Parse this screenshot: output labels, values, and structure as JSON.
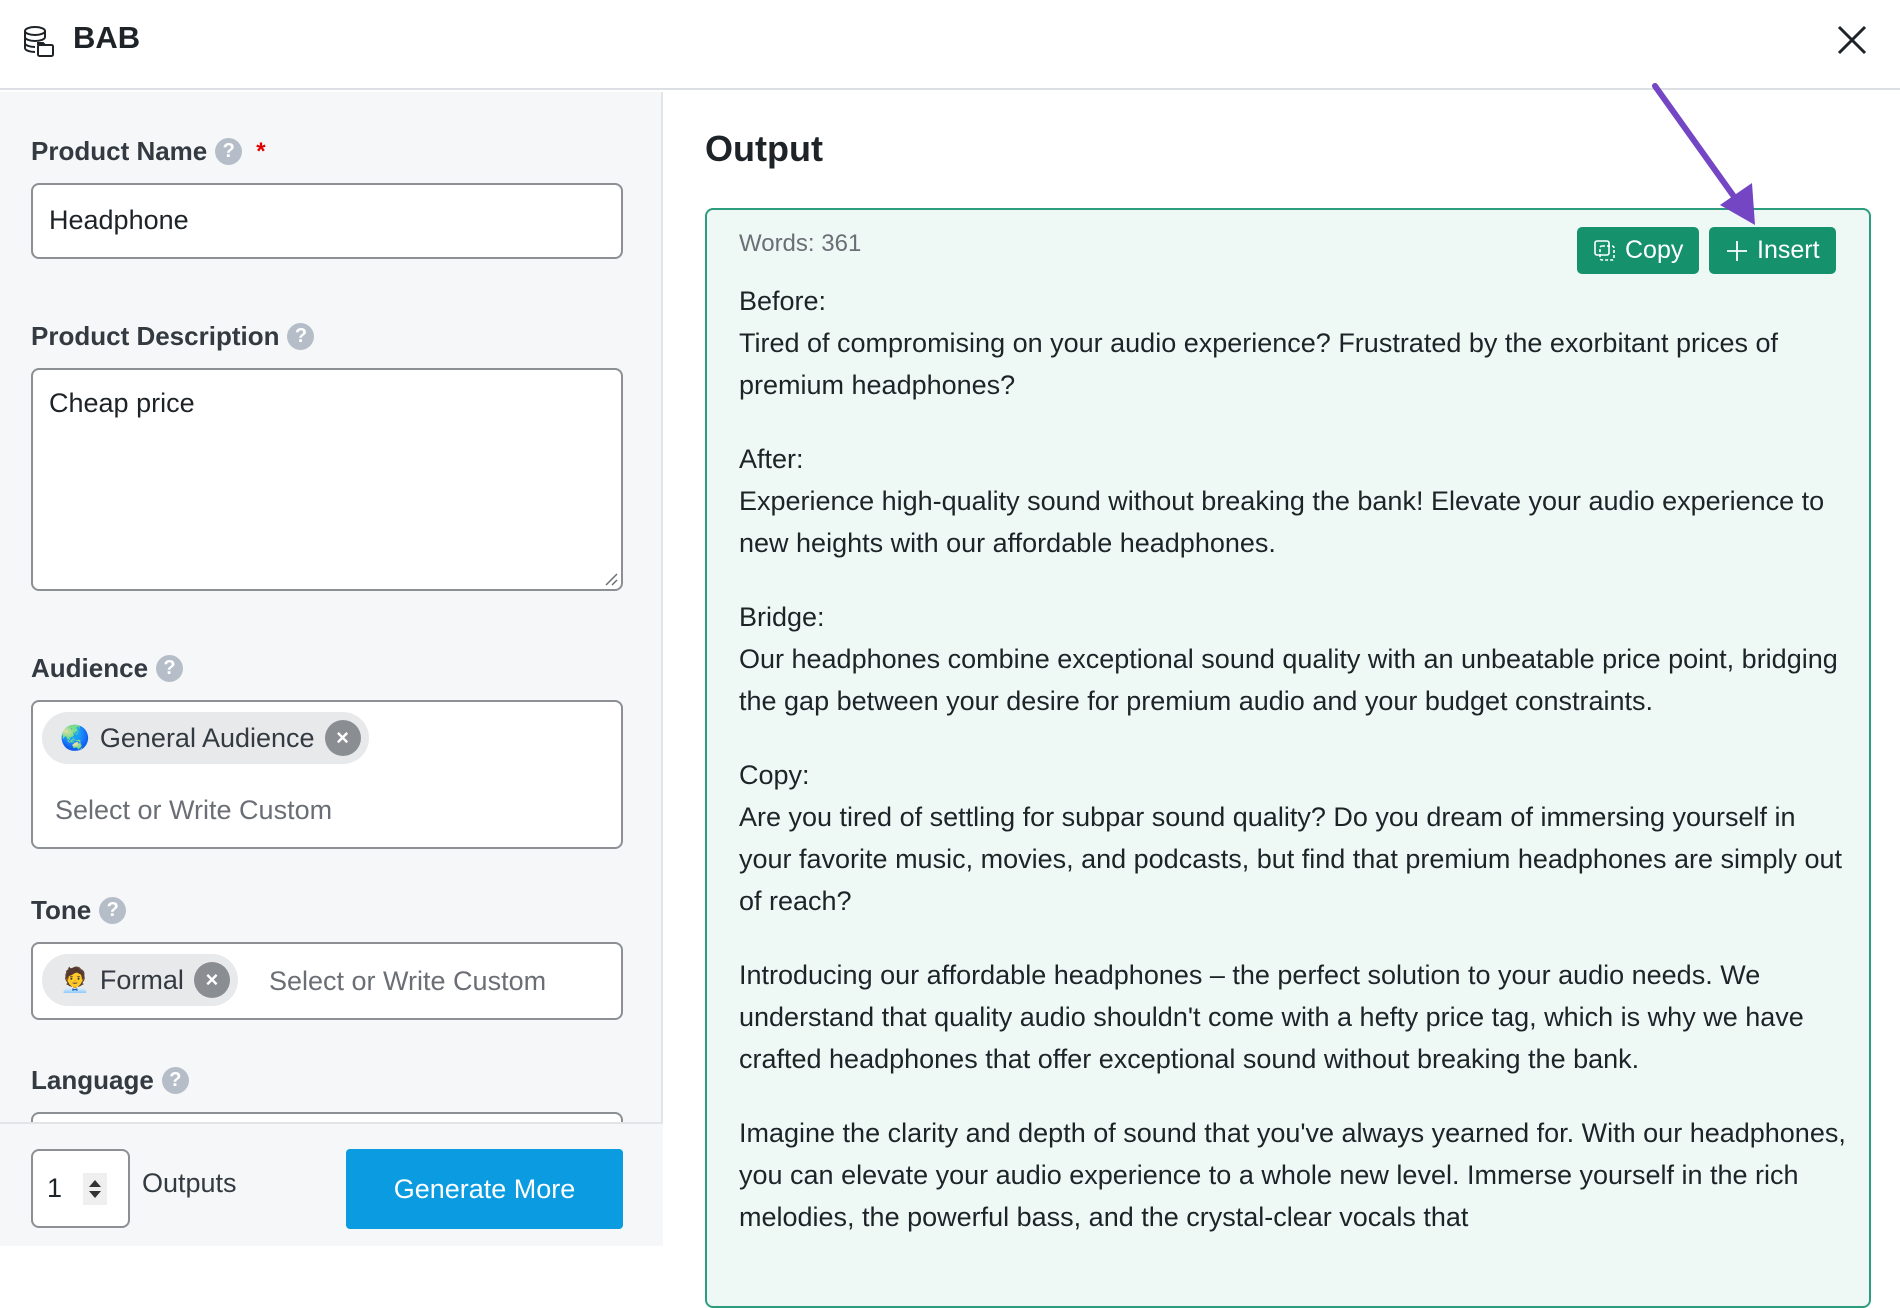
{
  "header": {
    "title": "BAB",
    "logo_icon": "database-folder-icon",
    "close_icon": "close-icon"
  },
  "form": {
    "product_name": {
      "label": "Product Name",
      "help": "?",
      "required_mark": "*",
      "value": "Headphone"
    },
    "product_description": {
      "label": "Product Description",
      "help": "?",
      "value": "Cheap price"
    },
    "audience": {
      "label": "Audience",
      "help": "?",
      "chip_emoji": "🌏",
      "chip_label": "General Audience",
      "chip_remove": "×",
      "placeholder": "Select or Write Custom"
    },
    "tone": {
      "label": "Tone",
      "help": "?",
      "chip_emoji": "🧑‍💼",
      "chip_label": "Formal",
      "chip_remove": "×",
      "placeholder": "Select or Write Custom"
    },
    "language": {
      "label": "Language",
      "help": "?"
    }
  },
  "footer": {
    "outputs_value": "1",
    "outputs_label": "Outputs",
    "generate_button": "Generate More"
  },
  "output": {
    "title": "Output",
    "words": "Words: 361",
    "copy_button": "Copy",
    "insert_button": "Insert",
    "accent_color": "#15916c",
    "annotation_arrow_color": "#7446c4",
    "paragraphs": [
      {
        "heading": "Before:",
        "text": "Tired of compromising on your audio experience? Frustrated by the exorbitant prices of premium headphones?"
      },
      {
        "heading": "After:",
        "text": "Experience high-quality sound without breaking the bank! Elevate your audio experience to new heights with our affordable headphones."
      },
      {
        "heading": "Bridge:",
        "text": "Our headphones combine exceptional sound quality with an unbeatable price point, bridging the gap between your desire for premium audio and your budget constraints."
      },
      {
        "heading": "Copy:",
        "text": "Are you tired of settling for subpar sound quality? Do you dream of immersing yourself in your favorite music, movies, and podcasts, but find that premium headphones are simply out of reach?"
      },
      {
        "heading": "",
        "text": "Introducing our affordable headphones – the perfect solution to your audio needs. We understand that quality audio shouldn't come with a hefty price tag, which is why we have crafted headphones that offer exceptional sound without breaking the bank."
      },
      {
        "heading": "",
        "text": "Imagine the clarity and depth of sound that you've always yearned for. With our headphones, you can elevate your audio experience to a whole new level. Immerse yourself in the rich melodies, the powerful bass, and the crystal-clear vocals that"
      }
    ]
  }
}
